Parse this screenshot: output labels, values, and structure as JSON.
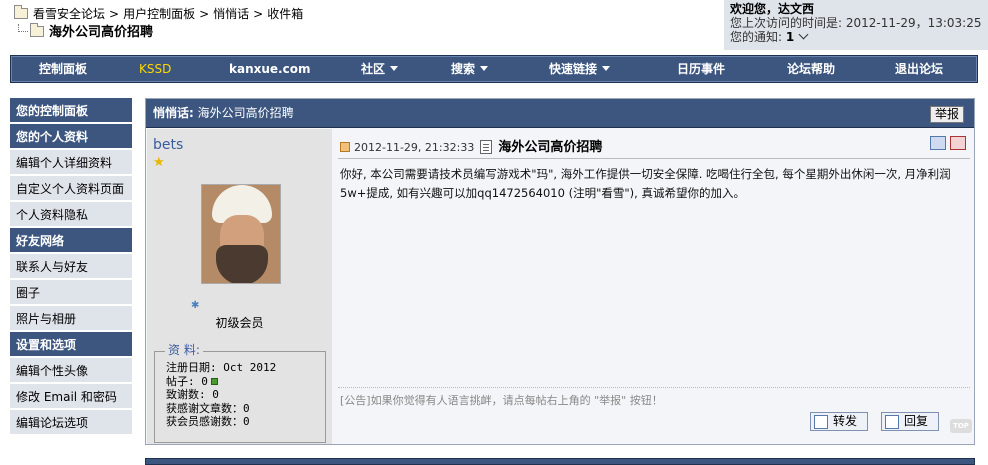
{
  "breadcrumb": {
    "items": [
      "看雪安全论坛",
      "用户控制面板",
      "悄悄话",
      "收件箱"
    ],
    "separator": ">",
    "current": "海外公司高价招聘"
  },
  "welcome": {
    "greeting": "欢迎您，达文西",
    "last_visit": "您上次访问的时间是: 2012-11-29，13:03:25",
    "notices_label": "您的通知:",
    "notices_count": "1"
  },
  "navbar": {
    "items": [
      "控制面板",
      "KSSD",
      "kanxue.com",
      "社区",
      "搜索",
      "快速链接",
      "日历事件",
      "论坛帮助",
      "退出论坛"
    ]
  },
  "sidebar": {
    "control_panel": "您的控制面板",
    "personal_header": "您的个人资料",
    "personal_items": [
      "编辑个人详细资料",
      "自定义个人资料页面",
      "个人资料隐私"
    ],
    "friends_header": "好友网络",
    "friends_items": [
      "联系人与好友",
      "圈子",
      "照片与相册"
    ],
    "settings_header": "设置和选项",
    "settings_items": [
      "编辑个性头像",
      "修改 Email 和密码",
      "编辑论坛选项"
    ]
  },
  "post": {
    "header_label": "悄悄话:",
    "header_title": "海外公司高价招聘",
    "report_button": "举报",
    "author": {
      "name": "bets",
      "rank": "初级会员",
      "info_legend": "资  料:",
      "reg_date": "注册日期: Oct 2012",
      "posts": "帖子: 0",
      "thanks": "致谢数: 0",
      "thanked_articles": "获感谢文章数：0",
      "thanked_by": "获会员感谢数：0"
    },
    "timestamp": "2012-11-29, 21:32:33",
    "title": "海外公司高价招聘",
    "body_line1": "你好, 本公司需要请技术员编写游戏术\"玛\", 海外工作提供一切安全保障. 吃喝住行全包, 每个星期外出休闲一次, 月净利润",
    "body_line2": "5w+提成, 如有兴趣可以加qq1472564010 (注明\"看雪\"), 真诚希望你的加入。",
    "notice": "[公告]如果你觉得有人语言挑衅，请点每帖右上角的 \"举报\" 按钮！",
    "forward_button": "转发",
    "reply_button": "回复",
    "top_label": "TOP"
  },
  "colors": {
    "nav_bg": "#3c5680",
    "sidebar_item_bg": "#dfe3ea",
    "kssd_accent": "#ffd800"
  }
}
